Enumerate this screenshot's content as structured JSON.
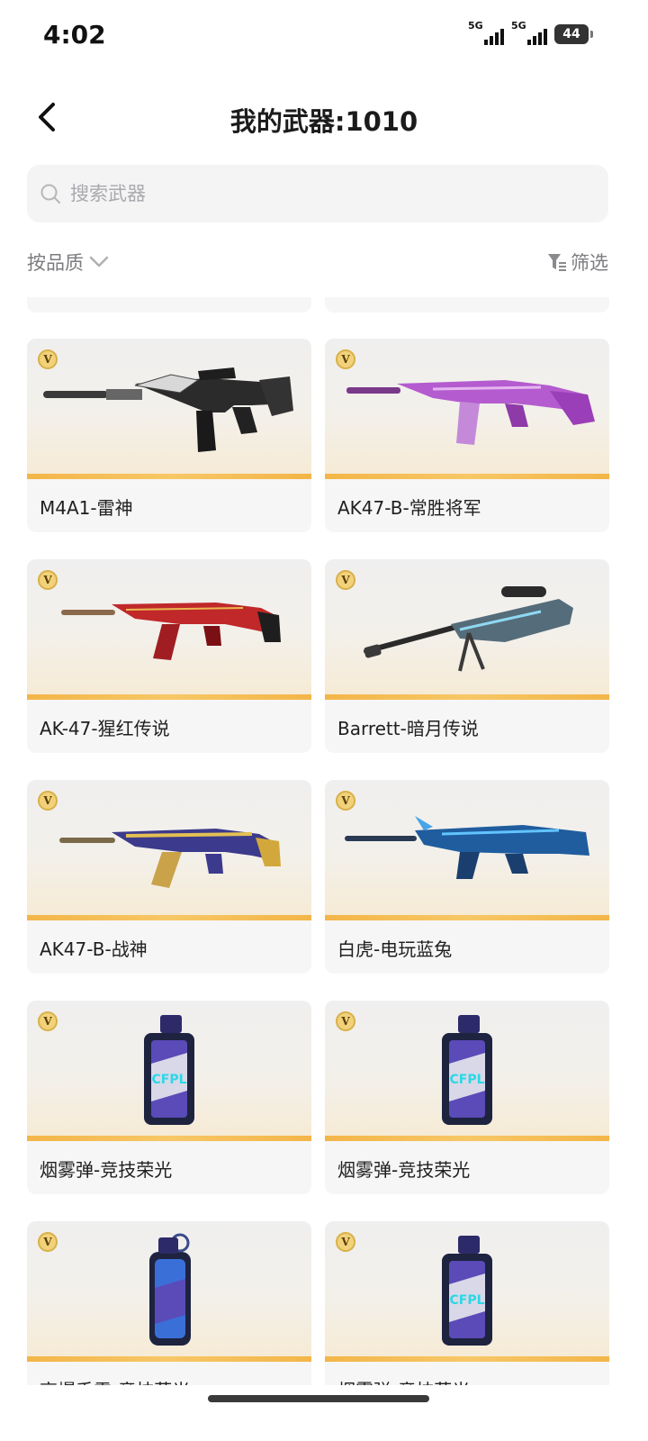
{
  "status_bar": {
    "time": "4:02",
    "signal_1_label": "5G",
    "signal_2_label": "5G",
    "battery": "44"
  },
  "header": {
    "title": "我的武器:1010"
  },
  "search": {
    "placeholder": "搜索武器"
  },
  "sort": {
    "label": "按品质"
  },
  "filter": {
    "label": "筛选"
  },
  "badge_symbol": "V",
  "items": [
    {
      "name": "M4A1-雷神",
      "icon": "m4a1-rifle-icon"
    },
    {
      "name": "AK47-B-常胜将军",
      "icon": "purple-ak47-icon"
    },
    {
      "name": "AK-47-猩红传说",
      "icon": "red-ak47-icon"
    },
    {
      "name": "Barrett-暗月传说",
      "icon": "sniper-rifle-icon"
    },
    {
      "name": "AK47-B-战神",
      "icon": "gold-ak47-icon"
    },
    {
      "name": "白虎-电玩蓝兔",
      "icon": "blue-rifle-icon"
    },
    {
      "name": "烟雾弹-竞技荣光",
      "icon": "smoke-grenade-icon"
    },
    {
      "name": "烟雾弹-竞技荣光",
      "icon": "smoke-grenade-icon"
    },
    {
      "name": "高爆手雷-竞技荣光",
      "icon": "frag-grenade-icon"
    },
    {
      "name": "烟雾弹-竞技荣光",
      "icon": "smoke-grenade-icon"
    }
  ],
  "colors": {
    "card_bg": "#f6f6f6",
    "accent_bar": "#f3b548",
    "search_bg": "#f4f4f5",
    "muted_text": "#7c7c80"
  }
}
